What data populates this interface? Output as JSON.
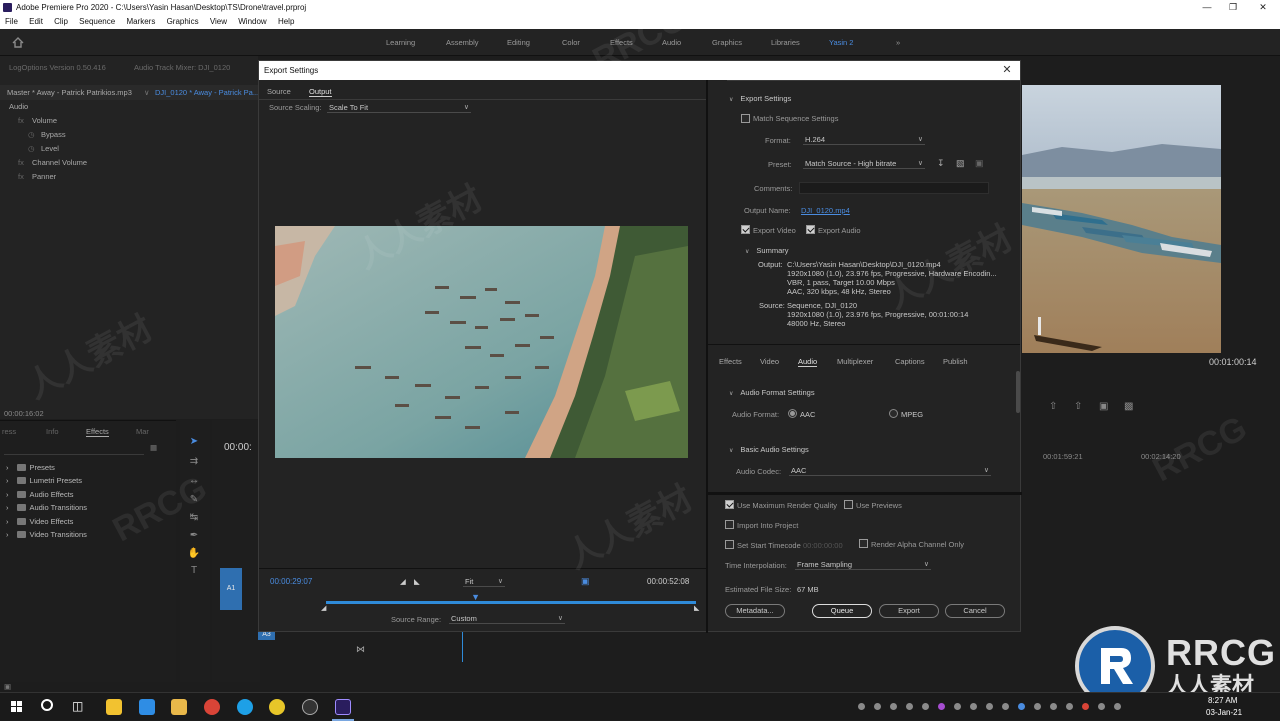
{
  "window": {
    "title": "Adobe Premiere Pro 2020 - C:\\Users\\Yasin Hasan\\Desktop\\TS\\Drone\\travel.prproj",
    "minimize": "—",
    "restore": "❐",
    "close": "✕"
  },
  "menu": [
    "File",
    "Edit",
    "Clip",
    "Sequence",
    "Markers",
    "Graphics",
    "View",
    "Window",
    "Help"
  ],
  "workspaces": [
    "Learning",
    "Assembly",
    "Editing",
    "Color",
    "Effects",
    "Audio",
    "Graphics",
    "Libraries",
    "Yasin 2"
  ],
  "workspaces_more": "»",
  "source_panel": {
    "tabs": [
      "LogOptions Version 0.50.416",
      "Audio Track Mixer: DJI_0120"
    ],
    "master": "Master * Away - Patrick Patrikios.mp3",
    "clip": "DJI_0120 * Away - Patrick Pa...",
    "section": "Audio",
    "rows": [
      "Volume",
      "Bypass",
      "Level",
      "Channel Volume",
      "Panner"
    ],
    "timecode": "00:00:16:02"
  },
  "effects_panel": {
    "tabs": [
      "ress",
      "Info",
      "Effects",
      "Mar"
    ],
    "items": [
      "Presets",
      "Lumetri Presets",
      "Audio Effects",
      "Audio Transitions",
      "Video Effects",
      "Video Transitions"
    ]
  },
  "timeline": {
    "timecode": "00:00:",
    "tracks": [
      "A1",
      "A3"
    ]
  },
  "program": {
    "timecode": "00:01:00:14",
    "ruler": [
      "00:01:59:21",
      "00:02:14:20"
    ]
  },
  "dialog": {
    "title": "Export Settings",
    "close": "✕",
    "tabs": [
      "Source",
      "Output"
    ],
    "active_tab": "Output",
    "source_scaling_label": "Source Scaling:",
    "source_scaling_value": "Scale To Fit",
    "export_settings": {
      "header": "Export Settings",
      "match_sequence": "Match Sequence Settings",
      "format_label": "Format:",
      "format_value": "H.264",
      "preset_label": "Preset:",
      "preset_value": "Match Source - High bitrate",
      "comments_label": "Comments:",
      "output_name_label": "Output Name:",
      "output_name_value": "DJI_0120.mp4",
      "export_video": "Export Video",
      "export_audio": "Export Audio"
    },
    "summary": {
      "header": "Summary",
      "output_label": "Output:",
      "output_lines": [
        "C:\\Users\\Yasin Hasan\\Desktop\\DJI_0120.mp4",
        "1920x1080 (1.0), 23.976 fps, Progressive, Hardware Encodin...",
        "VBR, 1 pass, Target 10.00 Mbps",
        "AAC, 320 kbps, 48 kHz, Stereo"
      ],
      "source_label": "Source:",
      "source_lines": [
        "Sequence, DJI_0120",
        "1920x1080 (1.0), 23.976 fps, Progressive, 00:01:00:14",
        "48000 Hz, Stereo"
      ]
    },
    "settings_tabs": [
      "Effects",
      "Video",
      "Audio",
      "Multiplexer",
      "Captions",
      "Publish"
    ],
    "active_settings_tab": "Audio",
    "audio_format": {
      "header": "Audio Format Settings",
      "label": "Audio Format:",
      "options": [
        "AAC",
        "MPEG"
      ]
    },
    "basic_audio": {
      "header": "Basic Audio Settings",
      "codec_label": "Audio Codec:",
      "codec_value": "AAC"
    },
    "options": {
      "max_render": "Use Maximum Render Quality",
      "previews": "Use Previews",
      "import": "Import Into Project",
      "start_timecode": "Set Start Timecode",
      "start_timecode_value": "00:00:00:00",
      "alpha_only": "Render Alpha Channel Only",
      "interp_label": "Time Interpolation:",
      "interp_value": "Frame Sampling",
      "filesize_label": "Estimated File Size:",
      "filesize_value": "67 MB"
    },
    "buttons": {
      "metadata": "Metadata...",
      "queue": "Queue",
      "export": "Export",
      "cancel": "Cancel"
    },
    "scrubber": {
      "current": "00:00:29:07",
      "duration": "00:00:52:08",
      "fit": "Fit",
      "source_range_label": "Source Range:",
      "source_range_value": "Custom",
      "playhead_fraction": 0.403
    }
  },
  "taskbar": {
    "time": "8:27 AM",
    "date": "03-Jan-21"
  },
  "watermarks": [
    "RRCG",
    "人人素材"
  ],
  "logo": {
    "brand": "RRCG",
    "subtitle": "人人素材"
  },
  "colors": {
    "accent": "#4a8ce0",
    "panel": "#232323",
    "timeline_blue": "#2f8bd9"
  }
}
